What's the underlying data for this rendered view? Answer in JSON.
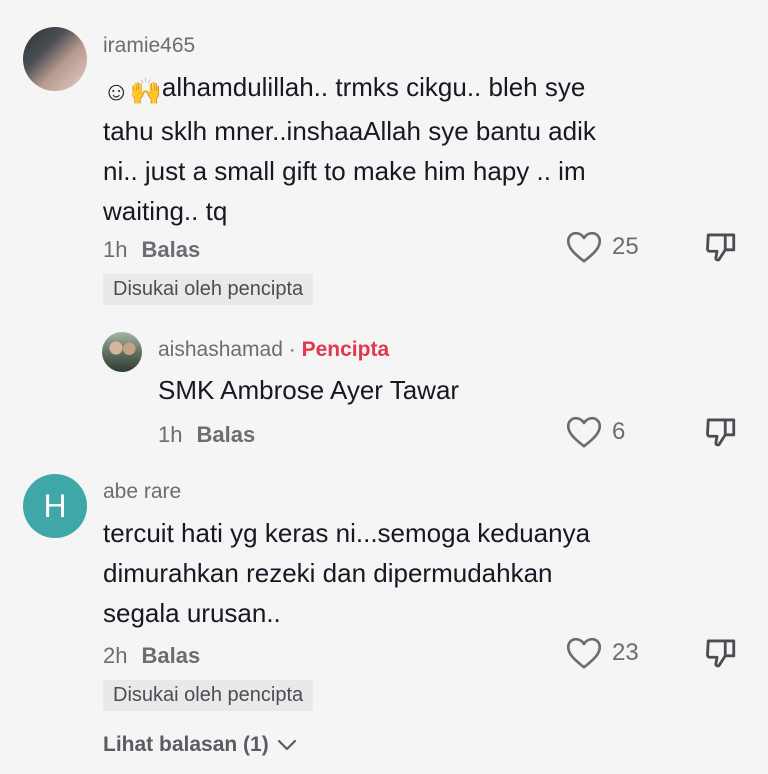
{
  "comments": [
    {
      "username": "iramie465",
      "emoji_prefix": "☺🙌",
      "lines": [
        "alhamdulillah.. trmks cikgu.. bleh sye",
        "tahu sklh mner..inshaaAllah sye bantu adik",
        "ni.. just a small gift to make him hapy .. im",
        "waiting.. tq"
      ],
      "time": "1h",
      "reply_label": "Balas",
      "likes": "25",
      "liked_by_creator": "Disukai oleh pencipta"
    },
    {
      "username": "aishashamad",
      "separator": "·",
      "creator_label": "Pencipta",
      "lines": [
        "SMK Ambrose Ayer Tawar"
      ],
      "time": "1h",
      "reply_label": "Balas",
      "likes": "6"
    },
    {
      "username": "abe rare",
      "avatar_letter": "H",
      "lines": [
        "tercuit hati yg keras ni...semoga keduanya",
        "dimurahkan rezeki dan dipermudahkan",
        "segala urusan.."
      ],
      "time": "2h",
      "reply_label": "Balas",
      "likes": "23",
      "liked_by_creator": "Disukai oleh pencipta"
    }
  ],
  "view_replies": "Lihat balasan (1)",
  "icons": {
    "like": "heart-outline-icon",
    "dislike": "thumbs-down-icon",
    "expand": "chevron-down-icon"
  },
  "colors": {
    "background": "#f5f5f5",
    "creator": "#e1384f",
    "avatar_letter_bg": "#3fa7a7"
  }
}
